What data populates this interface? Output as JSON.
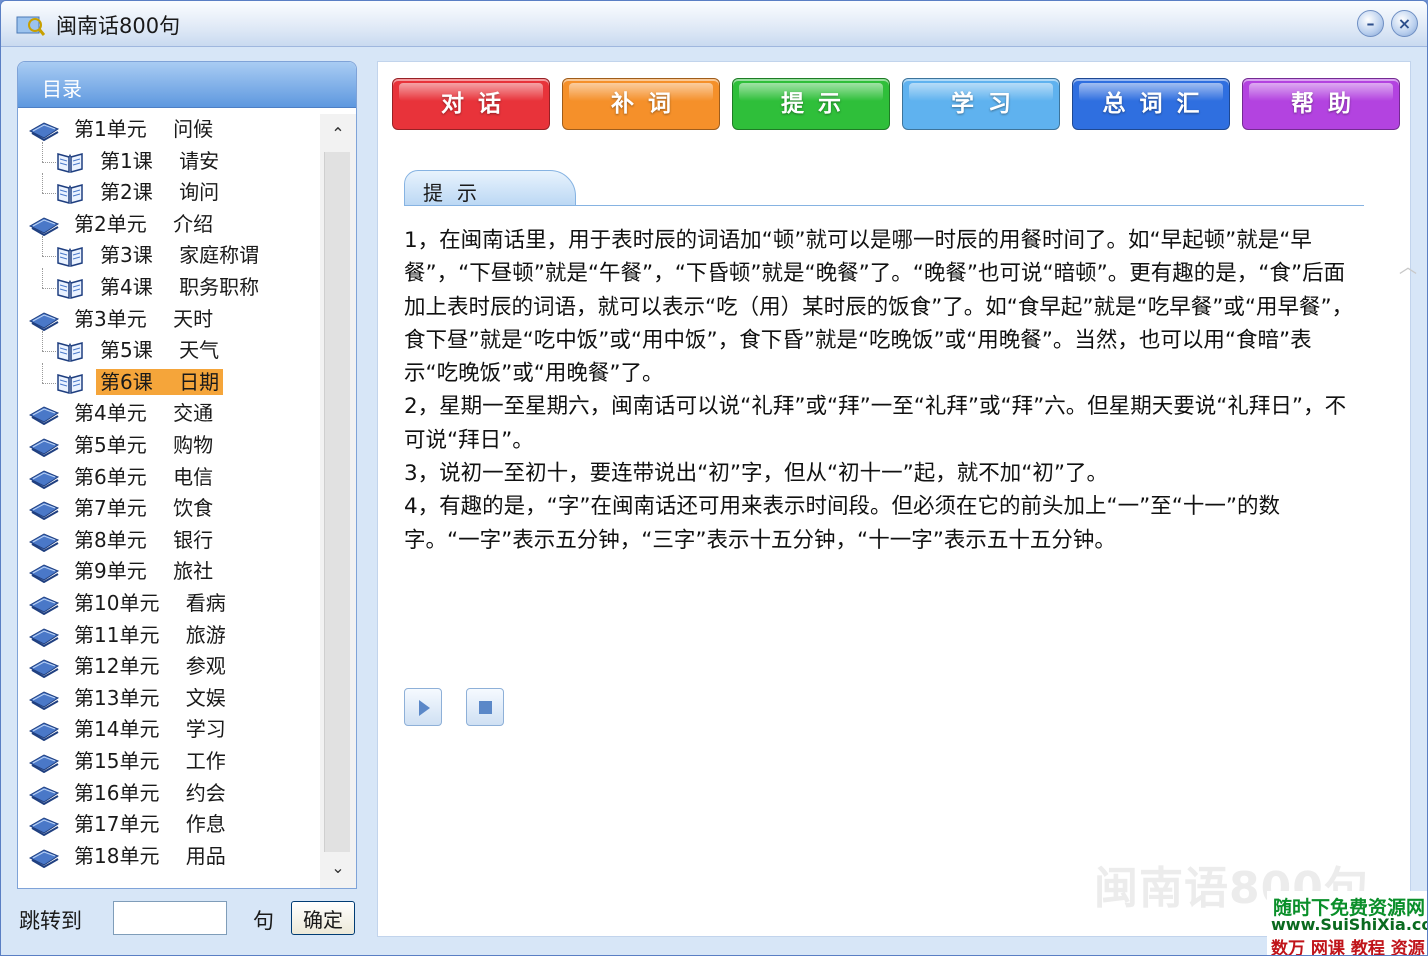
{
  "window": {
    "title": "闽南话800句"
  },
  "sidebar": {
    "header": "目录",
    "tree": [
      {
        "type": "unit",
        "label": "第1单元　 问候"
      },
      {
        "type": "lesson",
        "label": "第1课　 请安"
      },
      {
        "type": "lesson",
        "label": "第2课　 询问"
      },
      {
        "type": "unit",
        "label": "第2单元　 介绍"
      },
      {
        "type": "lesson",
        "label": "第3课　 家庭称谓"
      },
      {
        "type": "lesson",
        "label": "第4课　 职务职称"
      },
      {
        "type": "unit",
        "label": "第3单元　 天时"
      },
      {
        "type": "lesson",
        "label": "第5课　 天气"
      },
      {
        "type": "lesson",
        "label": "第6课　 日期",
        "selected": true
      },
      {
        "type": "unit",
        "label": "第4单元　 交通"
      },
      {
        "type": "unit",
        "label": "第5单元　 购物"
      },
      {
        "type": "unit",
        "label": "第6单元　 电信"
      },
      {
        "type": "unit",
        "label": "第7单元　 饮食"
      },
      {
        "type": "unit",
        "label": "第8单元　 银行"
      },
      {
        "type": "unit",
        "label": "第9单元　 旅社"
      },
      {
        "type": "unit",
        "label": "第10单元　 看病"
      },
      {
        "type": "unit",
        "label": "第11单元　 旅游"
      },
      {
        "type": "unit",
        "label": "第12单元　 参观"
      },
      {
        "type": "unit",
        "label": "第13单元　 文娱"
      },
      {
        "type": "unit",
        "label": "第14单元　 学习"
      },
      {
        "type": "unit",
        "label": "第15单元　 工作"
      },
      {
        "type": "unit",
        "label": "第16单元　 约会"
      },
      {
        "type": "unit",
        "label": "第17单元　 作息"
      },
      {
        "type": "unit",
        "label": "第18单元　 用品"
      }
    ],
    "scroll_up": "⌃",
    "scroll_down": "⌄"
  },
  "jump": {
    "label": "跳转到",
    "value": "",
    "unit": "句",
    "button": "确定"
  },
  "toolbar": {
    "tabs": [
      {
        "label": "对话",
        "color": "#e8333a"
      },
      {
        "label": "补词",
        "color": "#f5902a"
      },
      {
        "label": "提示",
        "color": "#2fbf3a"
      },
      {
        "label": "学习",
        "color": "#5fb2ef"
      },
      {
        "label": "总词汇",
        "color": "#2f6fe0"
      },
      {
        "label": "帮助",
        "color": "#b343e0"
      }
    ]
  },
  "content": {
    "section_title": "提示",
    "paragraphs": [
      "1，在闽南话里，用于表时辰的词语加“顿”就可以是哪一时辰的用餐时间了。如“早起顿”就是“早餐”，“下昼顿”就是“午餐”，“下昏顿”就是“晚餐”了。“晚餐”也可说“暗顿”。更有趣的是，“食”后面加上表时辰的词语，就可以表示“吃（用）某时辰的饭食”了。如“食早起”就是“吃早餐”或“用早餐”，食下昼”就是“吃中饭”或“用中饭”，食下昏”就是“吃晚饭”或“用晚餐”。当然，也可以用“食暗”表示“吃晚饭”或“用晚餐”了。",
      "2，星期一至星期六，闽南话可以说“礼拜”或“拜”一至“礼拜”或“拜”六。但星期天要说“礼拜日”，不可说“拜日”。",
      "3，说初一至初十，要连带说出“初”字，但从“初十一”起，就不加“初”了。",
      "4，有趣的是，“字”在闽南话还可用来表示时间段。但必须在它的前头加上“一”至“十一”的数字。“一字”表示五分钟，“三字”表示十五分钟，“十一字”表示五十五分钟。"
    ],
    "watermark": "闽南语800句"
  },
  "badge": {
    "line1": "随时下免费资源网",
    "line2": "www.SuiShiXia.com",
    "line3": "数万 网课 教程 资源"
  },
  "colors": {
    "selected": "#f5a53a",
    "header": "#5e98df"
  }
}
